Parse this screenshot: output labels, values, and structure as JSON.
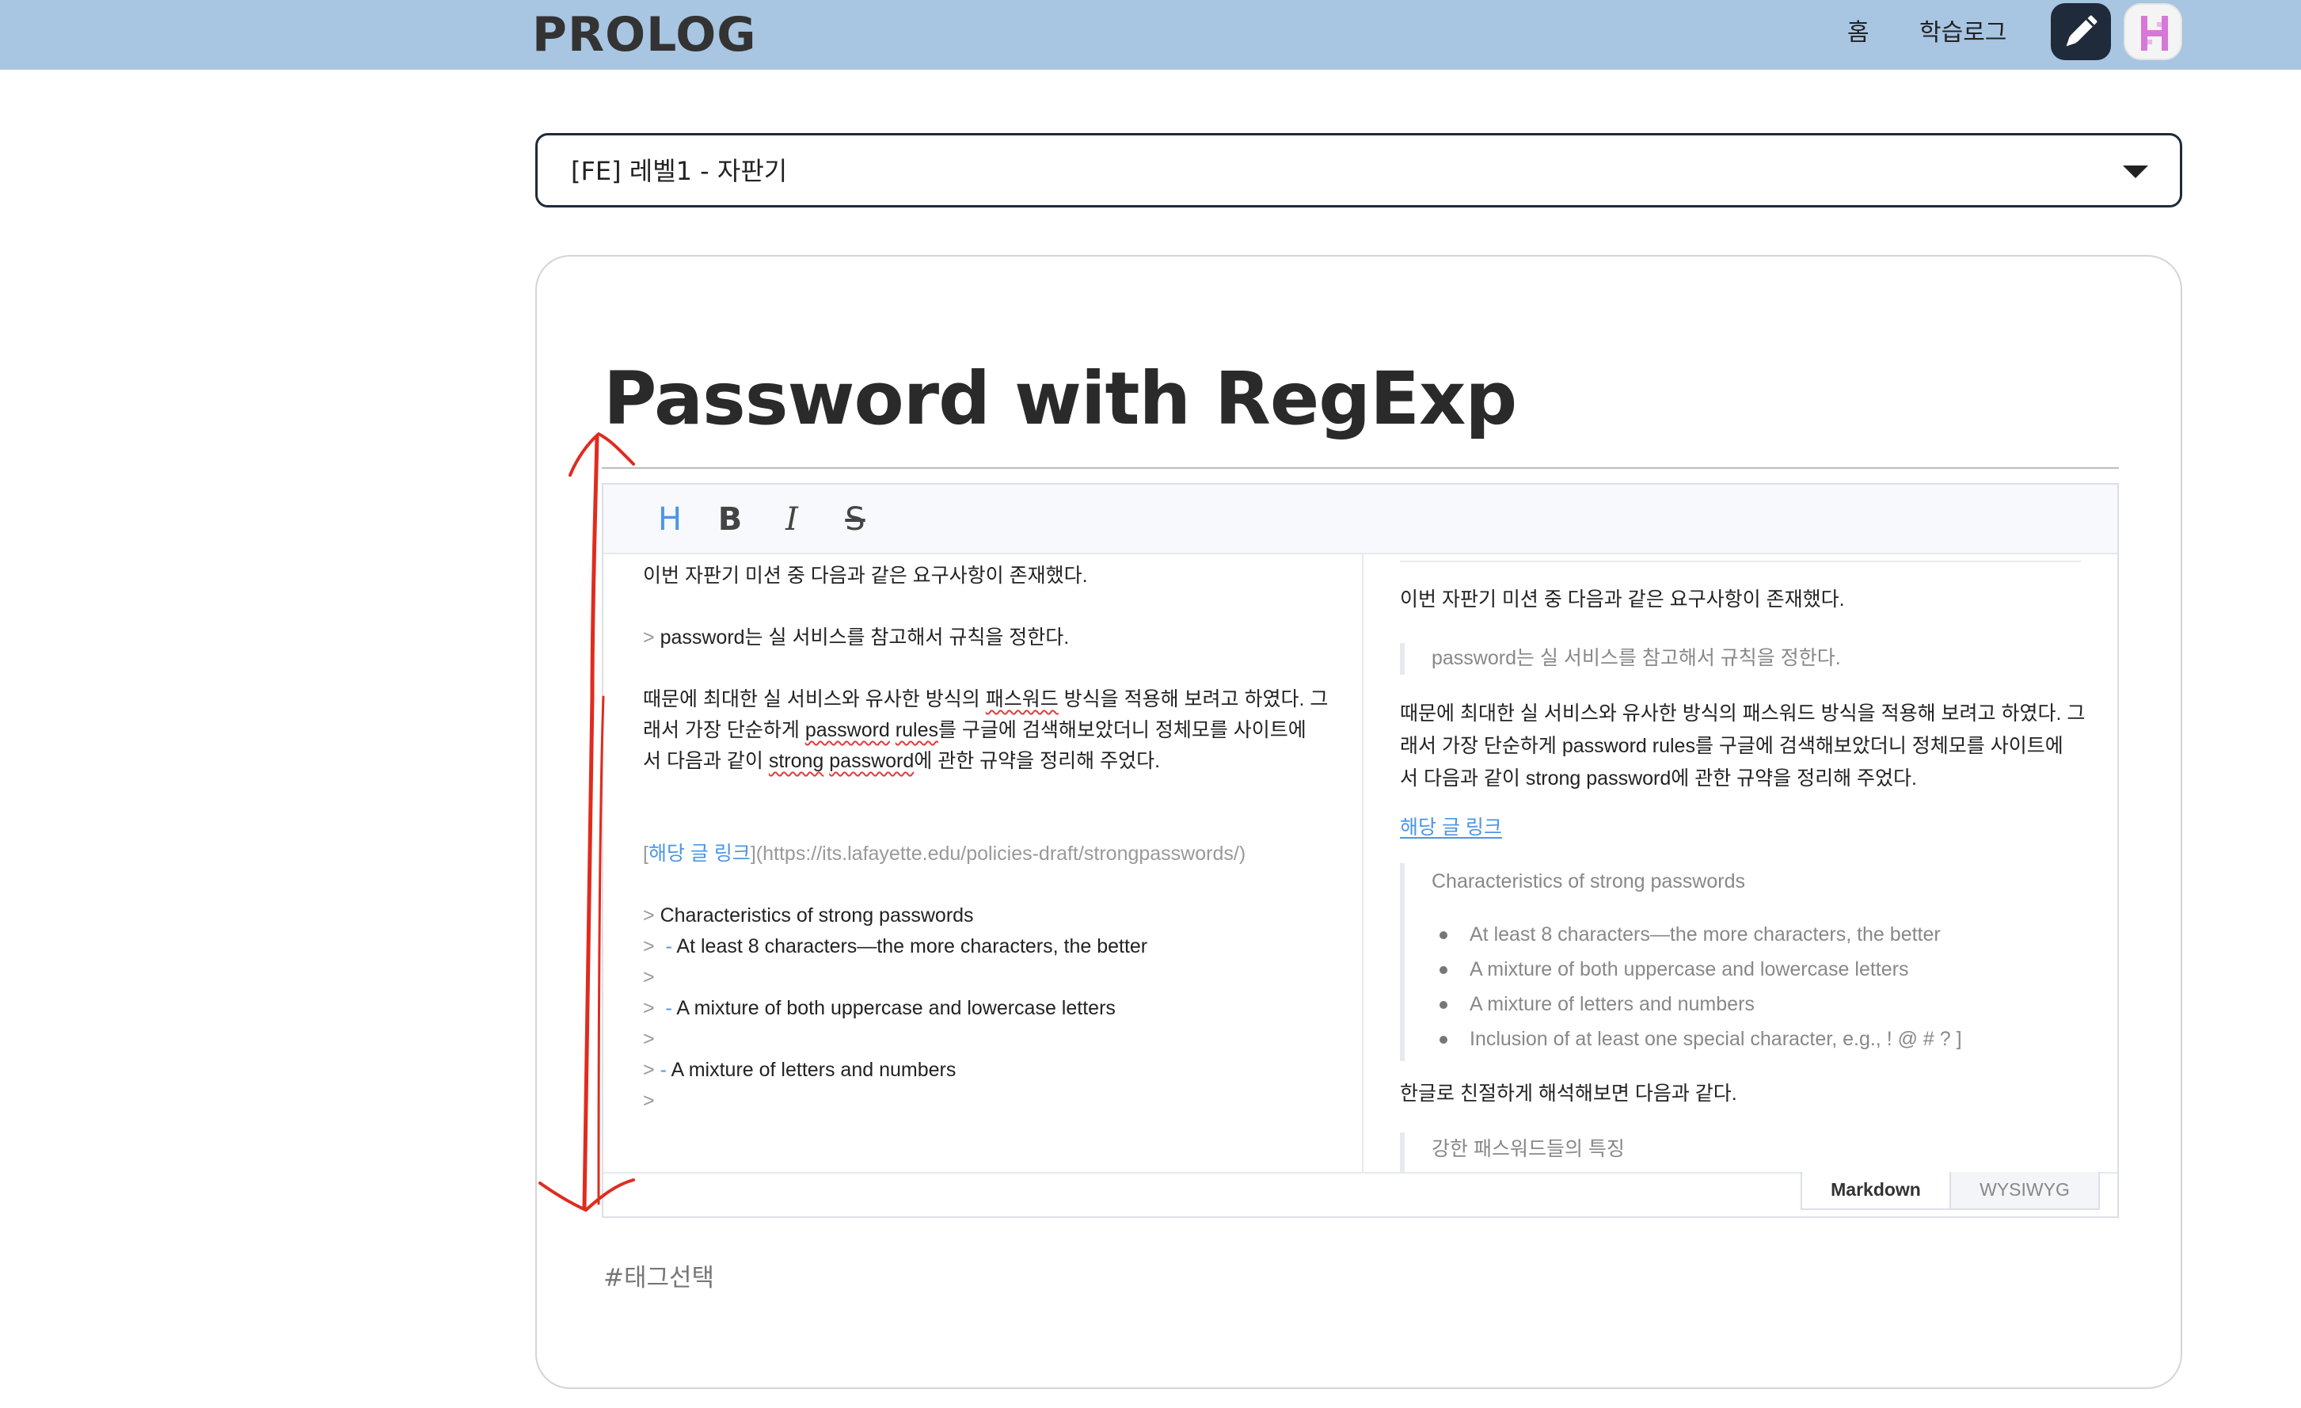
{
  "header": {
    "logo": "PROLOG",
    "nav": {
      "home": "홈",
      "study_log": "학습로그"
    }
  },
  "select": {
    "value": "[FE] 레벨1 - 자판기"
  },
  "post": {
    "title": "Password with RegExp"
  },
  "toolbar": {
    "heading": "H",
    "bold": "B",
    "italic": "I",
    "strike": "S"
  },
  "markdown": {
    "line1": "이번 자판기 미션 중 다음과 같은 요구사항이 존재했다.",
    "quote_mark": ">",
    "line2": "password는 실 서비스를 참고해서 규칙을 정한다.",
    "para_a": "때문에 최대한 실 서비스와 유사한 방식의 ",
    "para_a_sq": "패스워드",
    "para_a2": " 방식을 적용해 보려고 하였다. 그",
    "para_b": "래서 가장 단순하게 ",
    "para_b_sq1": "password",
    "para_b_sp": " ",
    "para_b_sq2": "rules",
    "para_b2": "를 구글에 검색해보았더니 정체모를 사이트에",
    "para_c": "서 다음과 같이 ",
    "para_c_sq1": "strong",
    "para_c_sp": " ",
    "para_c_sq2": "password",
    "para_c2": "에 관한 규약을 정리해 주었다.",
    "link_open": "[",
    "link_text": "해당 글 링크",
    "link_url": "](https://its.lafayette.edu/policies-draft/strongpasswords/)",
    "char_title": "Characteristics of strong passwords",
    "dash": "-",
    "item1": "At least 8 characters—the more characters, the better",
    "item2": "A mixture of both uppercase and lowercase letters",
    "item3": "A mixture of letters and numbers"
  },
  "preview": {
    "line1": "이번 자판기 미션 중 다음과 같은 요구사항이 존재했다.",
    "quote1": "password는 실 서비스를 참고해서 규칙을 정한다.",
    "para_a": "때문에 최대한 실 서비스와 유사한 방식의 패스워드 방식을 적용해 보려고 하였다. 그",
    "para_b": "래서 가장 단순하게 password rules를 구글에 검색해보았더니 정체모를 사이트에",
    "para_c": "서 다음과 같이 strong password에 관한 규약을 정리해 주었다.",
    "link_text": "해당 글 링크",
    "char_title": "Characteristics of strong passwords",
    "items": [
      "At least 8 characters—the more characters, the better",
      "A mixture of both uppercase and lowercase letters",
      "A mixture of letters and numbers",
      "Inclusion of at least one special character, e.g., ! @ # ? ]"
    ],
    "korean_line": "한글로 친절하게 해석해보면 다음과 같다.",
    "quote2": "강한 패스워드들의 특징"
  },
  "modes": {
    "markdown": "Markdown",
    "wysiwyg": "WYSIWYG"
  },
  "tags": {
    "placeholder": "#태그선택"
  },
  "colors": {
    "header_bg": "#a8c5e2",
    "accent": "#4b96e6",
    "annotation": "#e02b1f"
  }
}
